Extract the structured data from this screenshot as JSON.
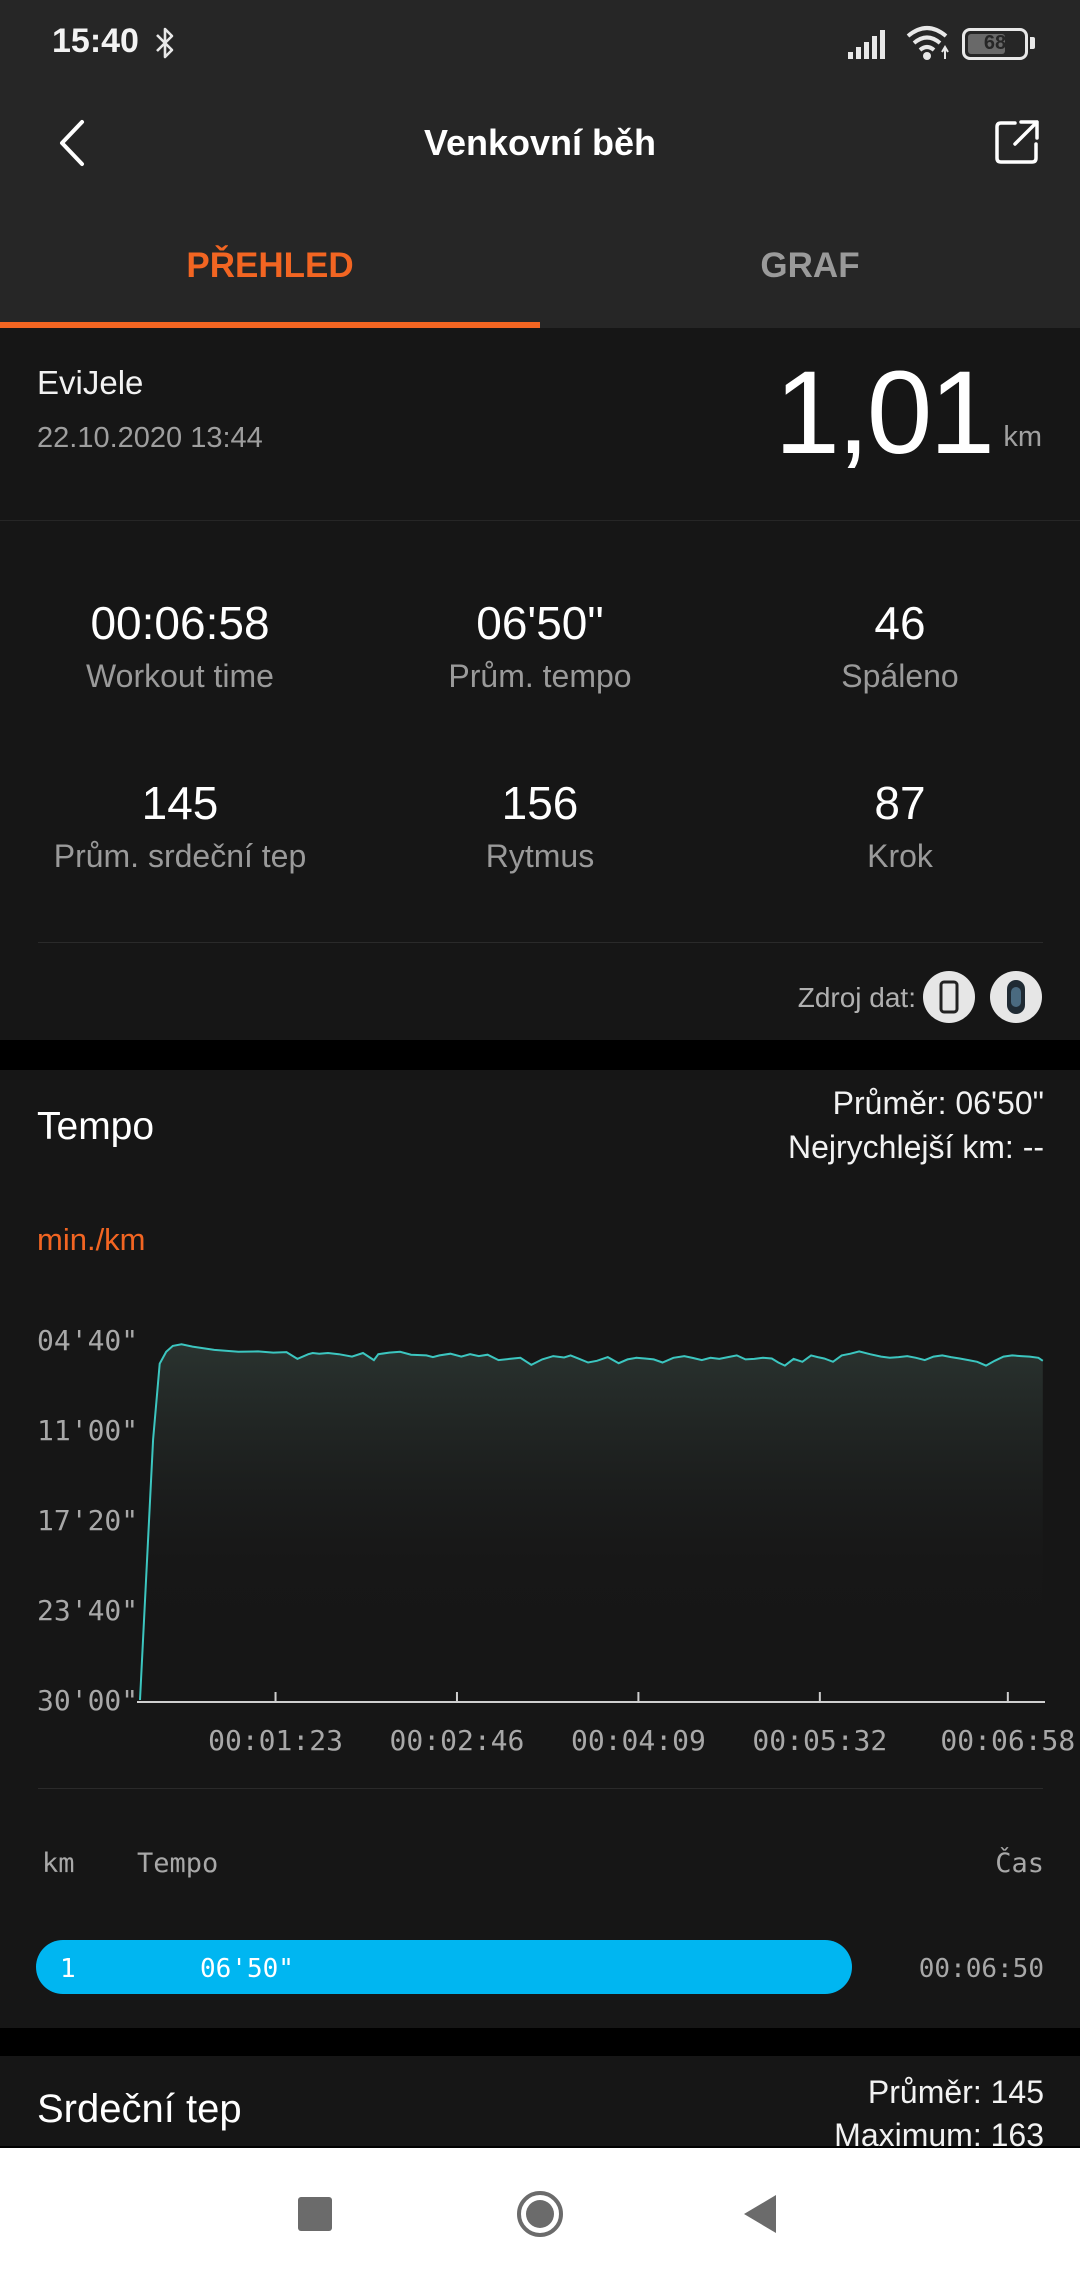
{
  "status_bar": {
    "time": "15:40",
    "battery": "68",
    "battery_level": 0.68
  },
  "header": {
    "title": "Venkovní běh",
    "tabs": [
      {
        "label": "PŘEHLED"
      },
      {
        "label": "GRAF"
      }
    ]
  },
  "summary": {
    "user": "EviJele",
    "date": "22.10.2020 13:44",
    "distance": "1,01",
    "distance_unit": "km",
    "stats": [
      {
        "value": "00:06:58",
        "label": "Workout time"
      },
      {
        "value": "06'50\"",
        "label": "Prům. tempo"
      },
      {
        "value": "46",
        "label": "Spáleno"
      },
      {
        "value": "145",
        "label": "Prům. srdeční tep"
      },
      {
        "value": "156",
        "label": "Rytmus"
      },
      {
        "value": "87",
        "label": "Krok"
      }
    ],
    "source_label": "Zdroj dat:"
  },
  "tempo": {
    "title": "Tempo",
    "average": "Průměr: 06'50\"",
    "fastest": "Nejrychlejší km: --",
    "unit": "min./km",
    "splits_header": {
      "km": "km",
      "tempo": "Tempo",
      "time": "Čas"
    },
    "split": {
      "km": "1",
      "pace": "06'50\"",
      "time": "00:06:50"
    }
  },
  "chart_data": {
    "type": "area",
    "xlabel": "",
    "ylabel": "min./km",
    "y_ticks": [
      "04'40\"",
      "11'00\"",
      "17'20\"",
      "23'40\"",
      "30'00\""
    ],
    "y_tick_values": [
      280,
      660,
      1040,
      1420,
      1800
    ],
    "y_range": [
      280,
      1800
    ],
    "y_inverted": true,
    "x_ticks": [
      "00:01:23",
      "00:02:46",
      "00:04:09",
      "00:05:32",
      "00:06:58"
    ],
    "x_tick_values": [
      83,
      166,
      249,
      332,
      418
    ],
    "x_range": [
      21,
      435
    ],
    "line_color": "#3cc6c0",
    "series": [
      {
        "x": [
          21,
          27,
          30,
          33,
          36,
          40,
          45,
          55,
          66,
          75,
          82,
          88,
          93,
          98,
          100,
          103,
          107,
          112,
          118,
          123,
          128,
          130,
          135,
          140,
          145,
          152,
          155,
          158,
          163,
          168,
          172,
          176,
          180,
          185,
          190,
          195,
          200,
          205,
          210,
          215,
          218,
          222,
          226,
          230,
          235,
          240,
          244,
          248,
          252,
          256,
          260,
          265,
          270,
          274,
          278,
          282,
          286,
          290,
          294,
          298,
          302,
          306,
          310,
          313,
          316,
          320,
          324,
          328,
          331,
          334,
          338,
          342,
          346,
          350,
          355,
          360,
          364,
          368,
          372,
          376,
          380,
          384,
          388,
          392,
          396,
          400,
          404,
          408,
          412,
          416,
          420,
          424,
          428,
          432,
          434
        ],
        "y": [
          1800,
          700,
          380,
          330,
          305,
          298,
          308,
          322,
          330,
          328,
          333,
          331,
          360,
          340,
          335,
          338,
          335,
          340,
          350,
          335,
          365,
          340,
          333,
          330,
          342,
          345,
          352,
          345,
          338,
          350,
          340,
          348,
          342,
          365,
          360,
          355,
          385,
          362,
          348,
          354,
          345,
          360,
          375,
          368,
          352,
          378,
          362,
          355,
          358,
          362,
          375,
          355,
          348,
          356,
          365,
          355,
          360,
          352,
          345,
          362,
          360,
          355,
          358,
          375,
          388,
          360,
          372,
          345,
          352,
          358,
          372,
          345,
          338,
          328,
          340,
          350,
          355,
          352,
          348,
          355,
          365,
          350,
          345,
          352,
          358,
          365,
          372,
          388,
          368,
          350,
          345,
          348,
          350,
          355,
          368
        ]
      }
    ]
  },
  "heart": {
    "title": "Srdeční tep",
    "average": "Průměr: 145",
    "max": "Maximum: 163"
  },
  "colors": {
    "accent": "#f26522",
    "chart_line": "#3cc6c0",
    "split_bar": "#00b6f1",
    "background": "#161616"
  }
}
